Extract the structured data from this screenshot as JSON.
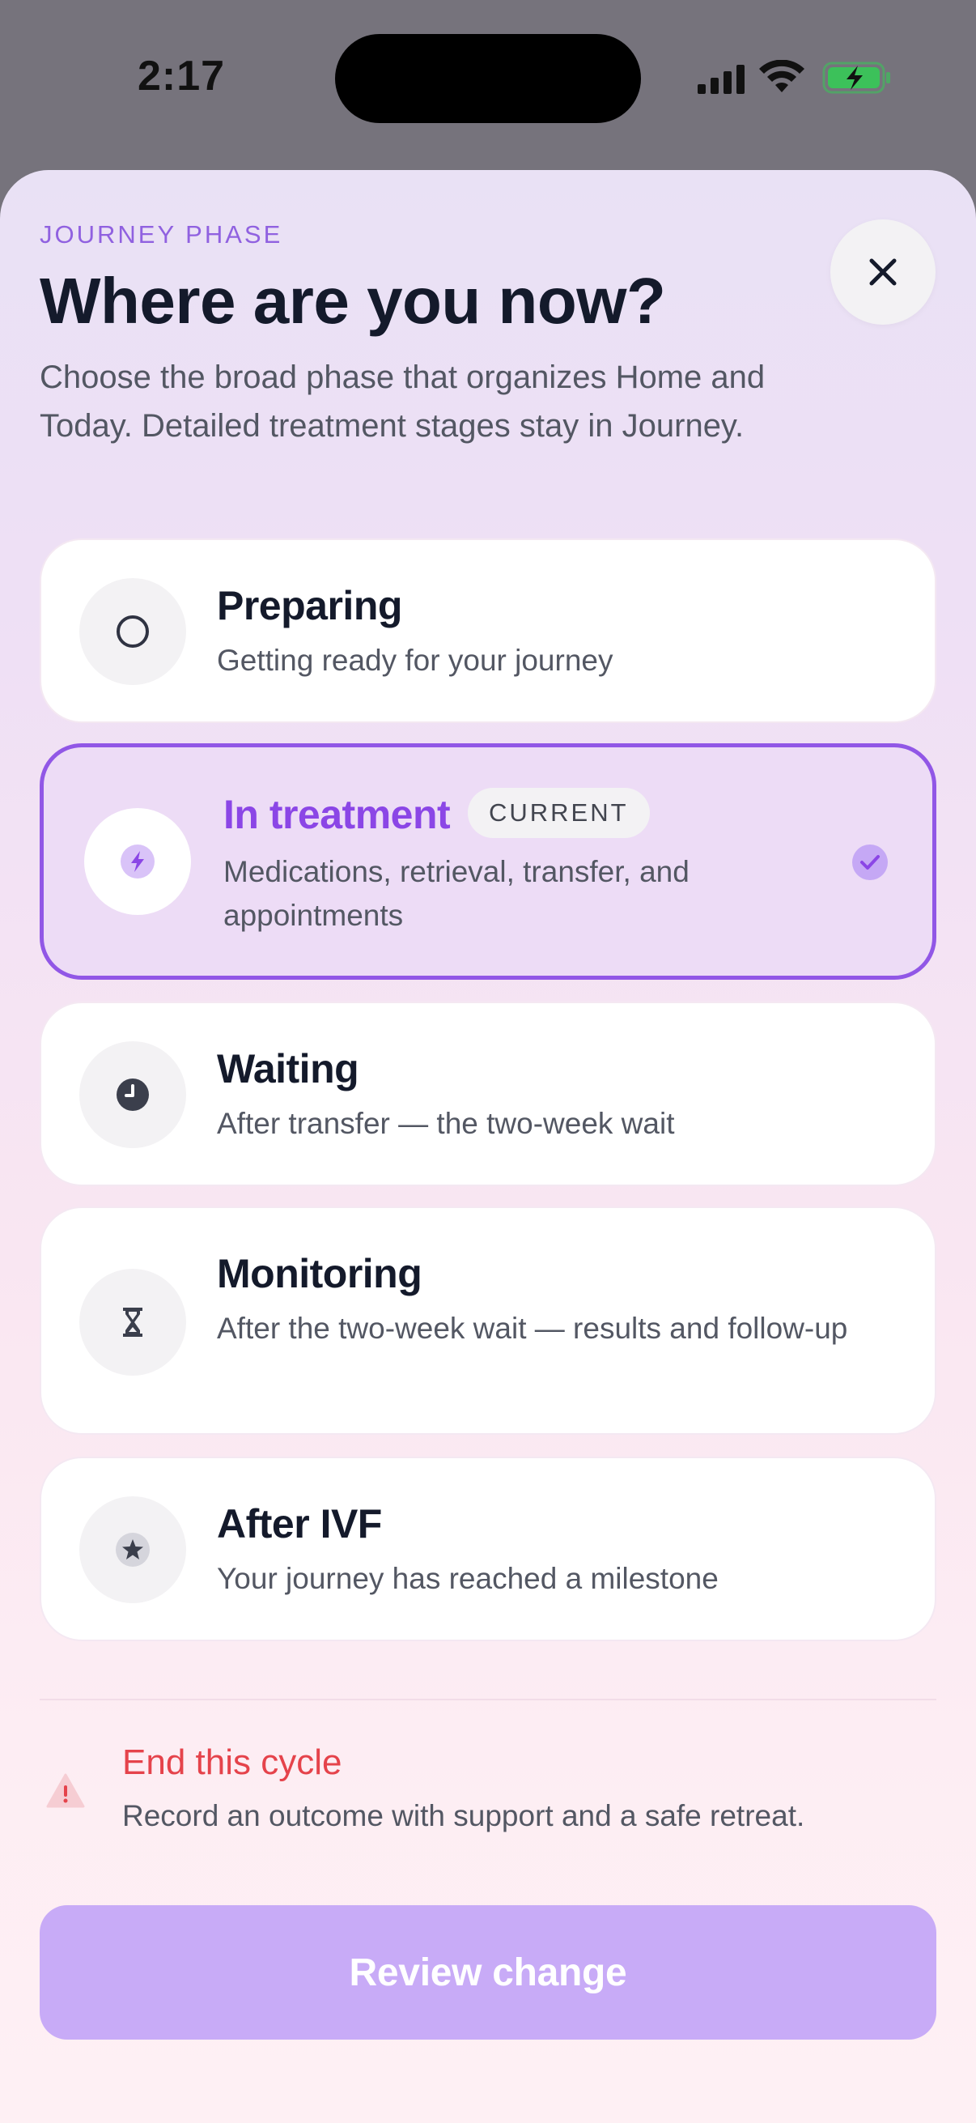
{
  "status_bar": {
    "time": "2:17",
    "icons": [
      "signal-icon",
      "wifi-icon",
      "battery-charging-icon"
    ],
    "battery_color": "#3cc15a"
  },
  "sheet": {
    "eyebrow": "JOURNEY PHASE",
    "title": "Where are you now?",
    "subtitle": "Choose the broad phase that organizes Home and Today. Detailed treatment stages stay in Journey.",
    "close_icon": "close-icon"
  },
  "phases": [
    {
      "title": "Preparing",
      "description": "Getting ready for your journey",
      "icon": "circle-outline-icon",
      "selected": false
    },
    {
      "title": "In treatment",
      "description": "Medications, retrieval, transfer, and appointments",
      "icon": "lightning-icon",
      "badge": "CURRENT",
      "selected": true
    },
    {
      "title": "Waiting",
      "description": "After transfer — the two-week wait",
      "icon": "clock-icon",
      "selected": false
    },
    {
      "title": "Monitoring",
      "description": "After the two-week wait — results and follow-up",
      "icon": "hourglass-icon",
      "selected": false
    },
    {
      "title": "After IVF",
      "description": "Your journey has reached a milestone",
      "icon": "star-icon",
      "selected": false
    }
  ],
  "end_cycle": {
    "title": "End this cycle",
    "description": "Record an outcome with support and a safe retreat.",
    "icon": "warning-icon"
  },
  "review_button": {
    "label": "Review change"
  },
  "colors": {
    "accent": "#9157e6",
    "danger": "#e5434b",
    "button_disabled": "#c8abf7"
  }
}
